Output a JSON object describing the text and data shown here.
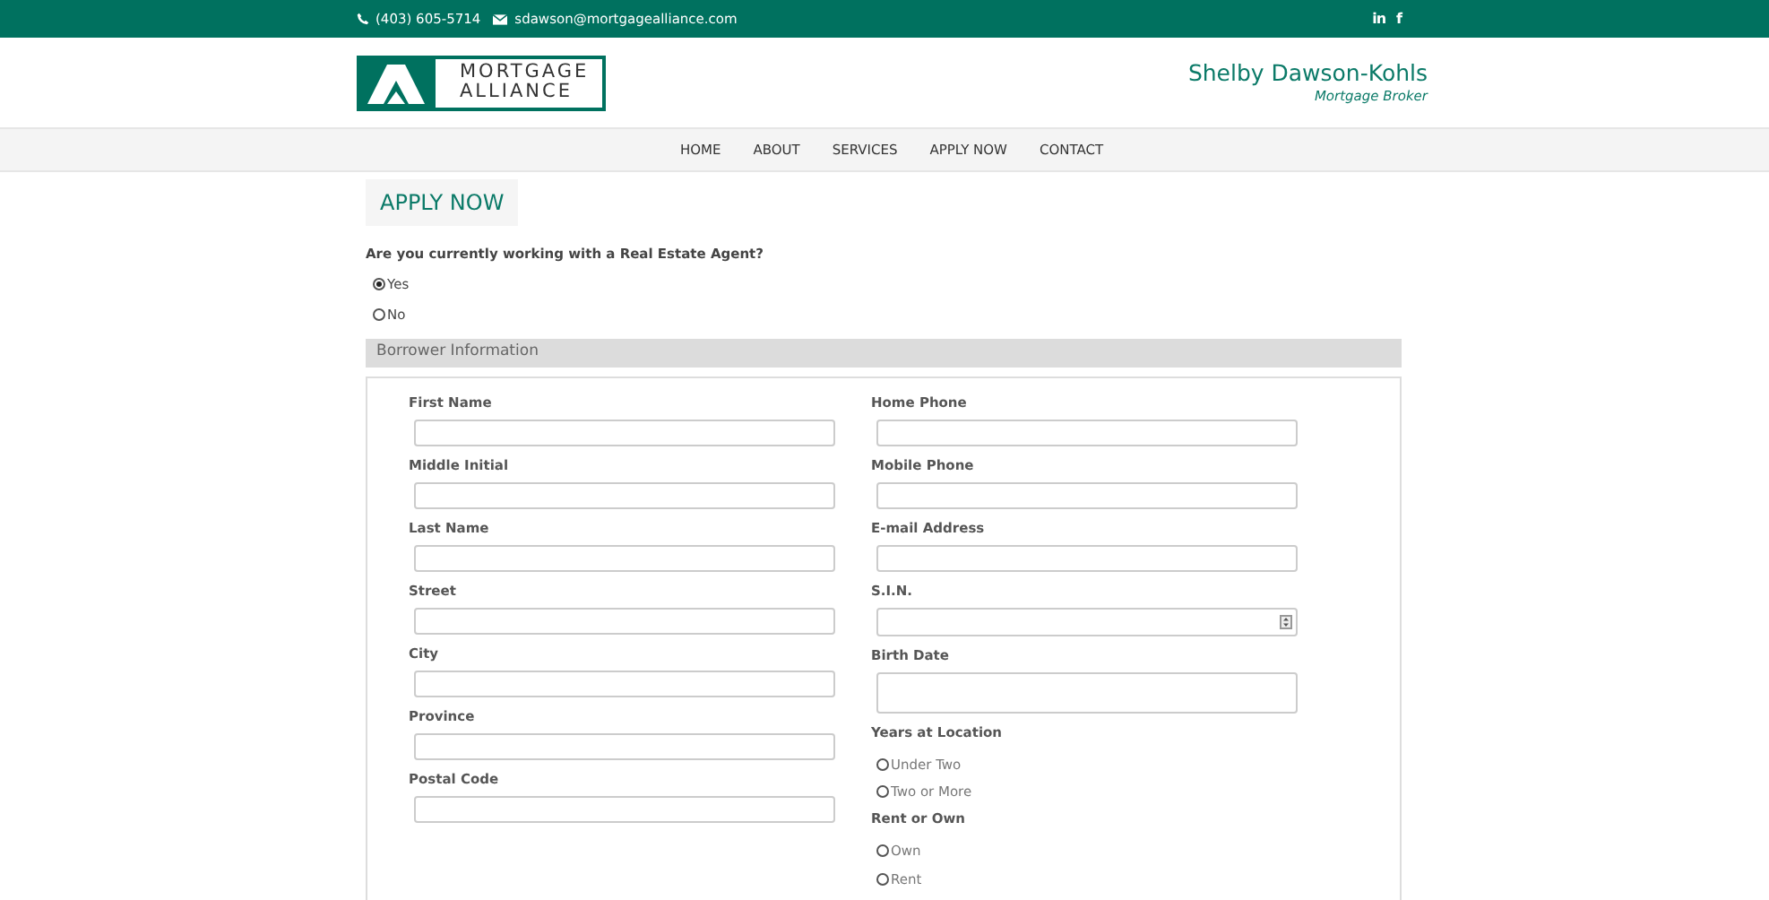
{
  "top_bar": {
    "phone": "(403) 605-5714",
    "email": "sdawson@mortgagealliance.com",
    "social": [
      {
        "kind": "linkedin",
        "label": "in"
      },
      {
        "kind": "facebook",
        "label": "f"
      }
    ]
  },
  "header": {
    "logo": {
      "line_1": "MORTGAGE",
      "line_2": "ALLIANCE"
    },
    "name": "Shelby Dawson-Kohls",
    "role": "Mortgage Broker"
  },
  "nav": [
    {
      "label": "HOME"
    },
    {
      "label": "ABOUT"
    },
    {
      "label": "SERVICES"
    },
    {
      "label": "APPLY NOW"
    },
    {
      "label": "CONTACT"
    }
  ],
  "page_title": "APPLY NOW",
  "agent_question": {
    "label": "Are you currently working with a Real Estate Agent?",
    "options": [
      {
        "label": "Yes",
        "selected": true
      },
      {
        "label": "No",
        "selected": false
      }
    ]
  },
  "section": {
    "title": "Borrower Information",
    "left": [
      {
        "kind": "text_field",
        "label": "First Name"
      },
      {
        "kind": "text_field",
        "label": "Middle Initial"
      },
      {
        "kind": "text_field",
        "label": "Last Name"
      },
      {
        "kind": "text_field",
        "label": "Street"
      },
      {
        "kind": "text_field",
        "label": "City"
      },
      {
        "kind": "text_field",
        "label": "Province"
      },
      {
        "kind": "text_field",
        "label": "Postal Code"
      }
    ],
    "right": [
      {
        "kind": "text_field",
        "label": "Home Phone"
      },
      {
        "kind": "text_field",
        "label": "Mobile Phone"
      },
      {
        "kind": "text_field",
        "label": "E-mail Address"
      },
      {
        "kind": "number_field",
        "label": "S.I.N."
      },
      {
        "kind": "date_field",
        "label": "Birth Date"
      },
      {
        "kind": "radio_group",
        "label": "Years at Location",
        "options": [
          {
            "label": "Under Two",
            "selected": false
          },
          {
            "label": "Two or More",
            "selected": false
          }
        ]
      },
      {
        "kind": "radio_group",
        "label": "Rent or Own",
        "options": [
          {
            "label": "Own",
            "selected": false
          },
          {
            "label": "Rent",
            "selected": false
          }
        ]
      }
    ]
  }
}
